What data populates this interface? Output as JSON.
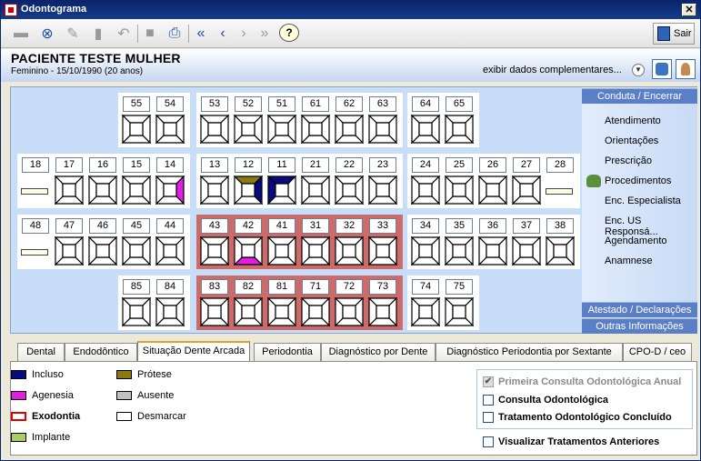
{
  "window": {
    "title": "Odontograma",
    "close_label": "✕"
  },
  "toolbar": {
    "icons": [
      "new-icon",
      "binoculars-icon",
      "erase-icon",
      "trash-icon",
      "undo-icon",
      "save-icon",
      "print-icon",
      "first-icon",
      "prev-icon",
      "next-icon",
      "last-icon",
      "help-icon"
    ],
    "sair_label": "Sair"
  },
  "patient": {
    "name": "PACIENTE TESTE MULHER",
    "info": "Feminino - 15/10/1990 (20 anos)",
    "more_label": "exibir dados complementares..."
  },
  "colors": {
    "incluso": "#0a0a80",
    "agenesia": "#e21ee2",
    "exodontia": "#e00000",
    "implante": "#a8d060",
    "protese": "#8a7a10",
    "ausente": "#c0c0c0",
    "desmarcar": "#ffffff",
    "row_background": "#cd6a6a",
    "dental_background": "#c8ddf8"
  },
  "odontogram": {
    "rows": [
      {
        "groups": [
          {
            "teeth": [
              "55",
              "54"
            ],
            "extracted": false
          },
          {
            "teeth": [
              "53",
              "52",
              "51",
              "61",
              "62",
              "63"
            ],
            "extracted": false
          },
          {
            "teeth": [
              "64",
              "65"
            ],
            "extracted": false
          }
        ]
      },
      {
        "groups": [
          {
            "teeth": [
              "18",
              "17",
              "16",
              "15",
              "14"
            ],
            "extracted": false
          },
          {
            "teeth": [
              "13",
              "12",
              "11",
              "21",
              "22",
              "23"
            ],
            "extracted": false
          },
          {
            "teeth": [
              "24",
              "25",
              "26",
              "27",
              "28"
            ],
            "extracted": false
          }
        ]
      },
      {
        "groups": [
          {
            "teeth": [
              "48",
              "47",
              "46",
              "45",
              "44"
            ],
            "extracted": false
          },
          {
            "teeth": [
              "43",
              "42",
              "41",
              "31",
              "32",
              "33"
            ],
            "extracted": true
          },
          {
            "teeth": [
              "34",
              "35",
              "36",
              "37",
              "38"
            ],
            "extracted": false
          }
        ]
      },
      {
        "groups": [
          {
            "teeth": [
              "85",
              "84"
            ],
            "extracted": false
          },
          {
            "teeth": [
              "83",
              "82",
              "81",
              "71",
              "72",
              "73"
            ],
            "extracted": true
          },
          {
            "teeth": [
              "74",
              "75"
            ],
            "extracted": false
          }
        ]
      }
    ],
    "absent_bar_teeth": [
      "18",
      "28",
      "48"
    ],
    "marks": {
      "14": {
        "right": "agenesia"
      },
      "12": {
        "top": "protese",
        "right": "incluso"
      },
      "11": {
        "top": "incluso",
        "left": "incluso"
      },
      "42": {
        "bottom": "agenesia"
      }
    }
  },
  "sidebar": {
    "header": "Conduta / Encerrar",
    "items": [
      "Atendimento",
      "Orientações",
      "Prescrição",
      "Procedimentos",
      "Enc. Especialista",
      "Enc. US Responsá...",
      "Agendamento",
      "Anamnese"
    ],
    "active_index": 3,
    "footer1": "Atestado / Declarações",
    "footer2": "Outras Informações"
  },
  "tabs": [
    "Dental",
    "Endodôntico",
    "Situação Dente Arcada",
    "Periodontia",
    "Diagnóstico por Dente",
    "Diagnóstico Periodontia por Sextante",
    "CPO-D / ceo"
  ],
  "active_tab": 2,
  "legend": {
    "incluso": "Incluso",
    "agenesia": "Agenesia",
    "exodontia": "Exodontia",
    "implante": "Implante",
    "protese": "Prótese",
    "ausente": "Ausente",
    "desmarcar": "Desmarcar"
  },
  "checks": {
    "primeira": "Primeira Consulta Odontológica Anual",
    "consulta": "Consulta Odontológica",
    "tratamento": "Tratamento Odontológico Concluído",
    "visualizar": "Visualizar Tratamentos Anteriores"
  }
}
